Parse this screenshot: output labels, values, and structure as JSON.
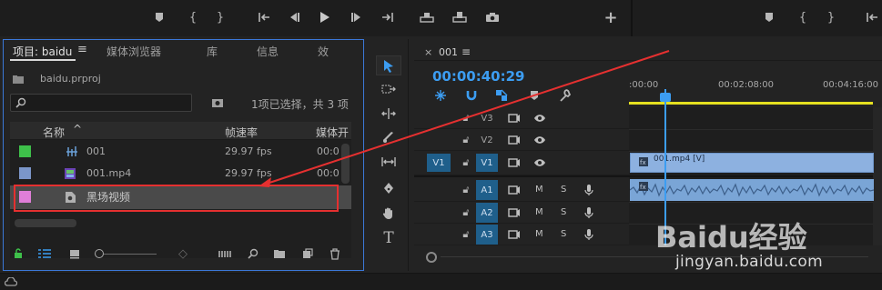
{
  "transport": {
    "marker_icon": "marker-icon",
    "in_icon": "mark-in-icon",
    "out_icon": "mark-out-icon",
    "goto_in_icon": "go-to-in-icon",
    "step_back_icon": "step-back-icon",
    "play_icon": "play-icon",
    "step_fwd_icon": "step-forward-icon",
    "goto_out_icon": "go-to-out-icon",
    "insert_icon": "insert-icon",
    "overwrite_icon": "overwrite-icon",
    "export_frame_icon": "camera-icon",
    "add_icon": "plus-icon"
  },
  "project_panel": {
    "tabs": [
      "项目: baidu",
      "媒体浏览器",
      "库",
      "信息",
      "效"
    ],
    "menu_glyph": "≡",
    "project_file": "baidu.prproj",
    "search_placeholder": "",
    "selection_status": "1项已选择，共 3 项",
    "columns": {
      "name": "名称",
      "frame_rate": "帧速率",
      "media_start": "媒体开"
    },
    "items": [
      {
        "name": "001",
        "frame_rate": "29.97 fps",
        "media_start": "00:0",
        "color": "#3ec04a",
        "icon": "sequence-icon"
      },
      {
        "name": "001.mp4",
        "frame_rate": "29.97 fps",
        "media_start": "00:0",
        "color": "#7b96c9",
        "icon": "video-clip-icon"
      },
      {
        "name": "黑场视频",
        "frame_rate": "",
        "media_start": "",
        "color": "#e07ed8",
        "icon": "black-video-icon"
      }
    ]
  },
  "timeline": {
    "sequence_name": "001",
    "menu_glyph": "≡",
    "timecode": "00:00:40:29",
    "ruler_labels": [
      ":00:00",
      "00:02:08:00",
      "00:04:16:00"
    ],
    "video_tracks": [
      {
        "source": "",
        "target": "V3"
      },
      {
        "source": "",
        "target": "V2"
      },
      {
        "source": "V1",
        "target": "V1"
      }
    ],
    "audio_tracks": [
      {
        "target": "A1",
        "m": "M",
        "s": "S"
      },
      {
        "target": "A2",
        "m": "M",
        "s": "S"
      },
      {
        "target": "A3",
        "m": "M",
        "s": "S"
      }
    ],
    "v1_clip_label": "001.mp4 [V]"
  },
  "watermark": {
    "brand": "Baidu经验",
    "url": "jingyan.baidu.com"
  },
  "colors": {
    "accent_blue": "#3c9df2",
    "annotation_red": "#e53030",
    "work_area_yellow": "#e5e020"
  }
}
